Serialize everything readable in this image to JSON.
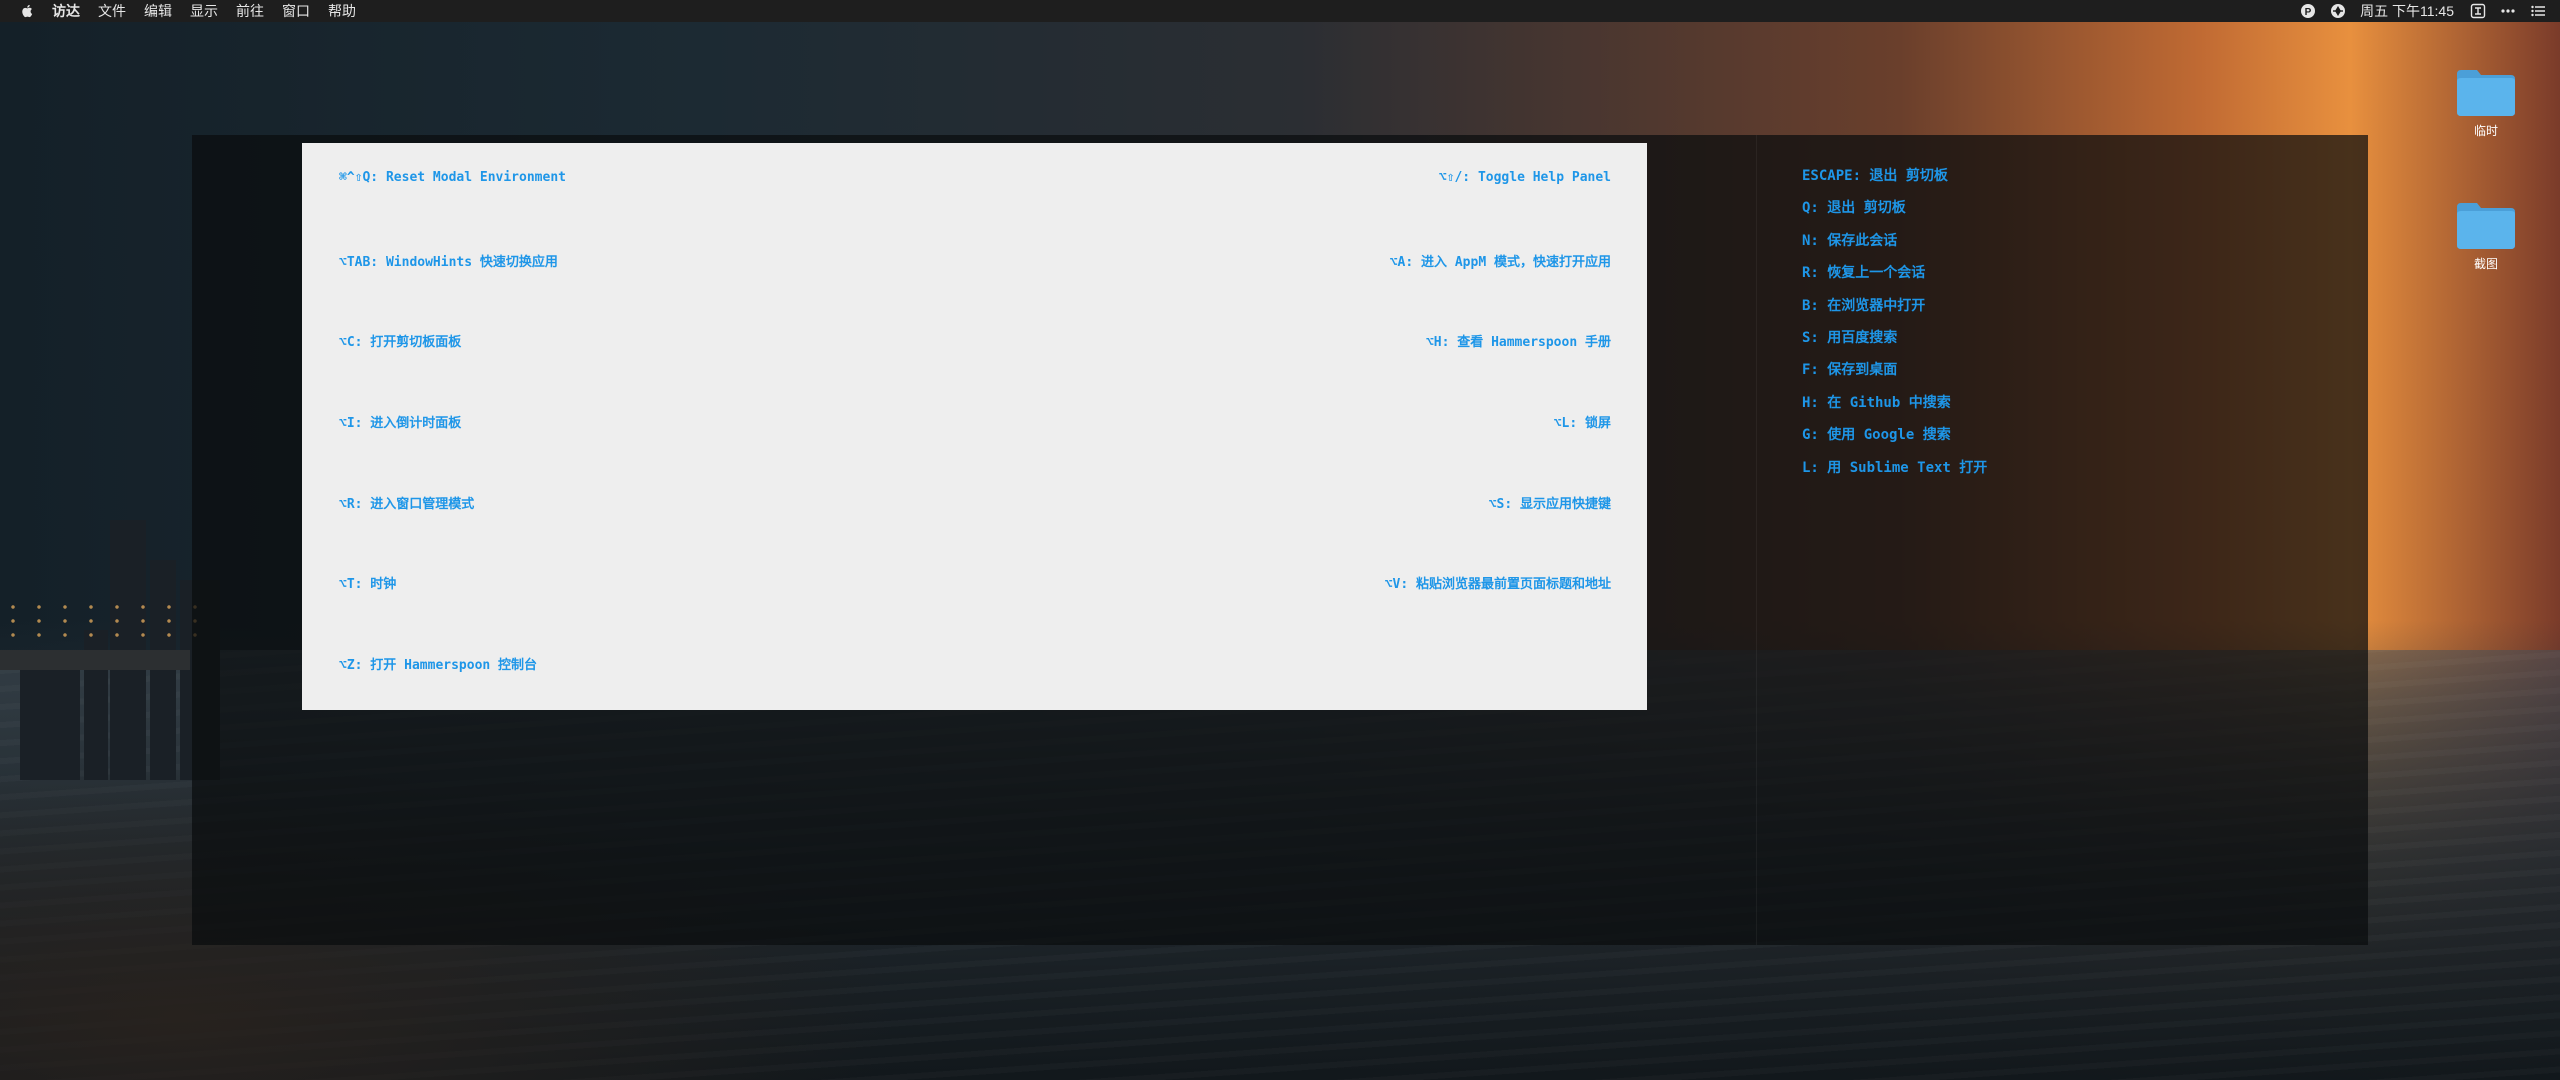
{
  "menubar": {
    "apple_icon": "apple-logo-icon",
    "items": [
      "访达",
      "文件",
      "编辑",
      "显示",
      "前往",
      "窗口",
      "帮助"
    ],
    "clock": "周五 下午11:45",
    "status_icons": [
      "p-circle-icon",
      "aperture-icon",
      "input-method-icon",
      "more-icon",
      "list-icon"
    ]
  },
  "desktop": {
    "icons": [
      {
        "label": "临时",
        "icon": "folder-icon"
      },
      {
        "label": "截图",
        "icon": "folder-icon"
      }
    ]
  },
  "help_panel": {
    "left_items": [
      "⌘^⇧Q: Reset Modal Environment",
      "⌥TAB: WindowHints 快速切换应用",
      "⌥C: 打开剪切板面板",
      "⌥I: 进入倒计时面板",
      "⌥R: 进入窗口管理模式",
      "⌥T: 时钟",
      "⌥Z: 打开 Hammerspoon 控制台"
    ],
    "right_items": [
      "⌥⇧/: Toggle Help Panel",
      "⌥A:  进入 AppM 模式，快速打开应用",
      "⌥H: 查看 Hammerspoon 手册",
      "⌥L: 锁屏",
      "⌥S: 显示应用快捷键",
      "⌥V: 粘贴浏览器最前置页面标题和地址"
    ]
  },
  "clipboard_modal": {
    "items": [
      "ESCAPE: 退出 剪切板",
      "Q: 退出 剪切板",
      "N: 保存此会话",
      "R: 恢复上一个会话",
      "B: 在浏览器中打开",
      "S: 用百度搜索",
      "F: 保存到桌面",
      "H: 在 Github 中搜索",
      "G: 使用 Google 搜索",
      "L: 用 Sublime Text 打开"
    ]
  },
  "colors": {
    "accent": "#1e96e8",
    "menubar_bg": "#1e1e1e",
    "panel_bg": "#eeeeee",
    "folder": "#5bb4ec"
  }
}
